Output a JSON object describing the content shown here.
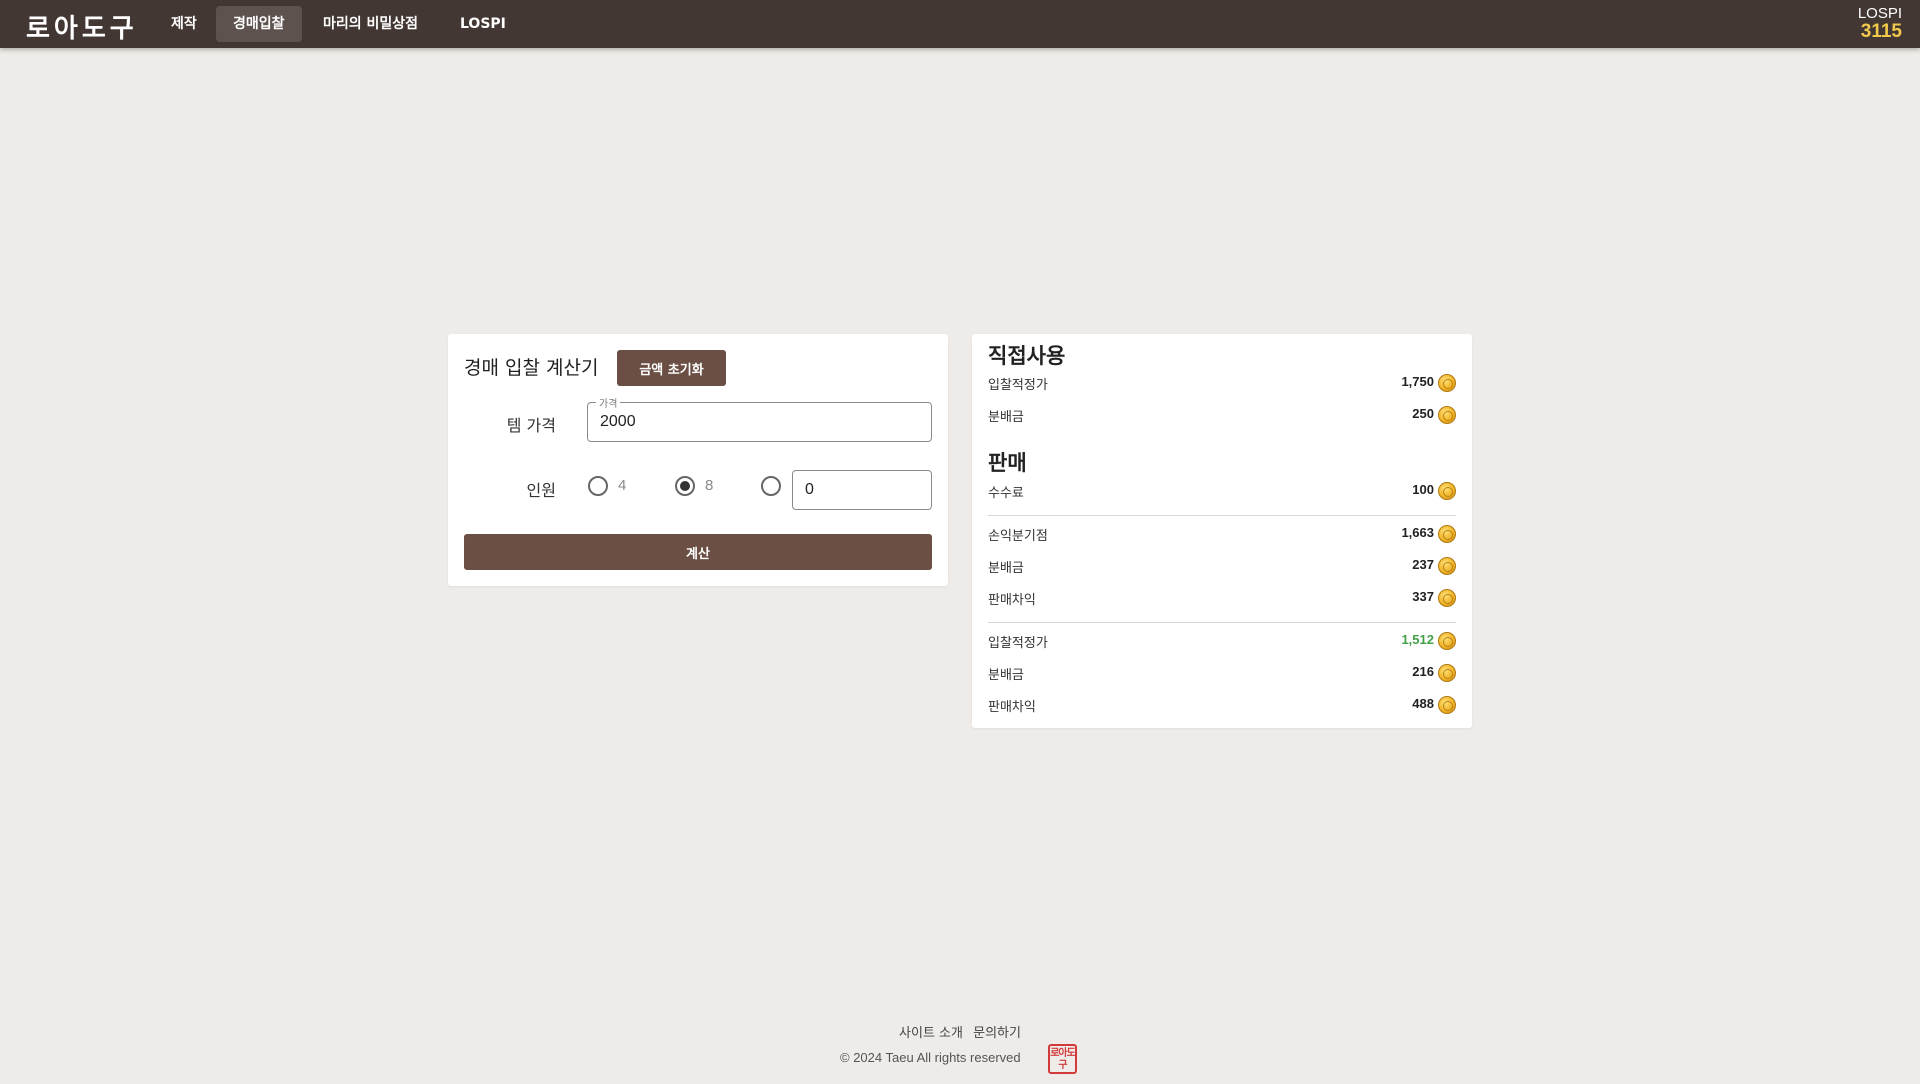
{
  "header": {
    "logo": "로아도구",
    "nav": [
      {
        "label": "제작",
        "active": false
      },
      {
        "label": "경매입찰",
        "active": true
      },
      {
        "label": "마리의 비밀상점",
        "active": false
      },
      {
        "label": "LOSPI",
        "active": false
      }
    ],
    "lospi": {
      "label": "LOSPI",
      "value": "3115"
    }
  },
  "calculator": {
    "title": "경매 입찰 계산기",
    "reset_label": "금액 초기화",
    "price_label": "템 가격",
    "price_legend": "가격",
    "price_value": "2000",
    "members_label": "인원",
    "member_options": [
      {
        "label": "4",
        "checked": false
      },
      {
        "label": "8",
        "checked": true
      },
      {
        "label": "",
        "checked": false
      }
    ],
    "custom_value": "0",
    "calc_label": "계산"
  },
  "result": {
    "direct_title": "직접사용",
    "direct_rows": [
      {
        "label": "입찰적정가",
        "value": "1,750"
      },
      {
        "label": "분배금",
        "value": "250"
      }
    ],
    "sell_title": "판매",
    "fee_row": {
      "label": "수수료",
      "value": "100"
    },
    "breakeven_rows": [
      {
        "label": "손익분기점",
        "value": "1,663"
      },
      {
        "label": "분배금",
        "value": "237"
      },
      {
        "label": "판매차익",
        "value": "337"
      }
    ],
    "optimal_rows": [
      {
        "label": "입찰적정가",
        "value": "1,512",
        "highlight": true
      },
      {
        "label": "분배금",
        "value": "216"
      },
      {
        "label": "판매차익",
        "value": "488"
      }
    ],
    "coin_icon": "gold-coin-icon"
  },
  "footer": {
    "links": [
      "사이트 소개",
      "문의하기"
    ],
    "copyright": "© 2024 Taeu All rights reserved",
    "stamp": "로아도구"
  },
  "colors": {
    "topbar": "#433733",
    "button": "#6b4f45",
    "background": "#efebe8",
    "lospi_value": "#f2c94c",
    "highlight": "#43a047"
  }
}
